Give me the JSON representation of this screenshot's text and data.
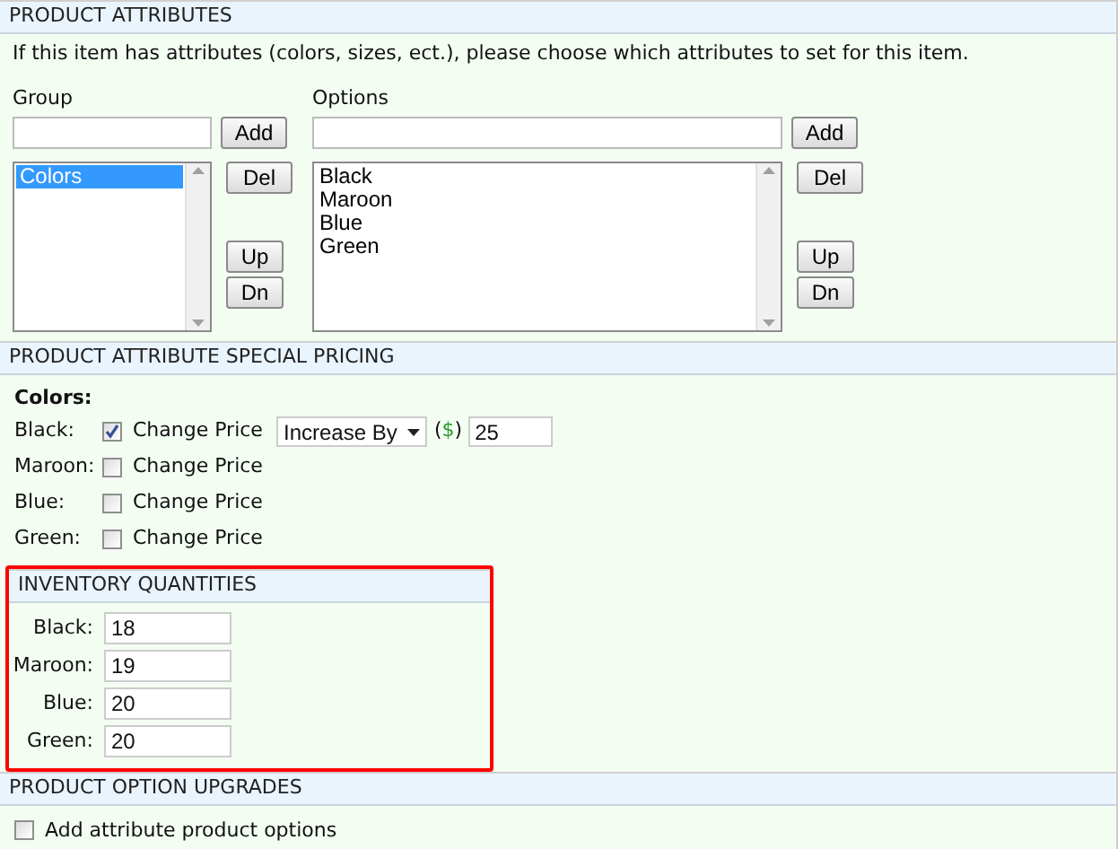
{
  "attributes": {
    "title": "PRODUCT ATTRIBUTES",
    "intro": "If this item has attributes (colors, sizes, ect.), please choose which attributes to set for this item.",
    "group": {
      "label": "Group",
      "add": "Add",
      "del": "Del",
      "up": "Up",
      "dn": "Dn",
      "items": [
        {
          "label": "Colors",
          "selected": true
        }
      ]
    },
    "options": {
      "label": "Options",
      "add": "Add",
      "del": "Del",
      "up": "Up",
      "dn": "Dn",
      "items": [
        {
          "label": "Black",
          "selected": false
        },
        {
          "label": "Maroon",
          "selected": false
        },
        {
          "label": "Blue",
          "selected": false
        },
        {
          "label": "Green",
          "selected": false
        }
      ]
    }
  },
  "pricing": {
    "title": "PRODUCT ATTRIBUTE SPECIAL PRICING",
    "group_label": "Colors:",
    "rows": [
      {
        "label": "Black:",
        "checked": true,
        "checkbox_label": "Change Price",
        "mode": "Increase By",
        "currency_open": "(",
        "currency": "$",
        "currency_close": ")",
        "amount": "25"
      },
      {
        "label": "Maroon:",
        "checked": false,
        "checkbox_label": "Change Price"
      },
      {
        "label": "Blue:",
        "checked": false,
        "checkbox_label": "Change Price"
      },
      {
        "label": "Green:",
        "checked": false,
        "checkbox_label": "Change Price"
      }
    ]
  },
  "inventory": {
    "title": "INVENTORY QUANTITIES",
    "highlighted": true,
    "rows": [
      {
        "label": "Black:",
        "value": "18"
      },
      {
        "label": "Maroon:",
        "value": "19"
      },
      {
        "label": "Blue:",
        "value": "20"
      },
      {
        "label": "Green:",
        "value": "20"
      }
    ]
  },
  "upgrades": {
    "title": "PRODUCT OPTION UPGRADES",
    "checked": false,
    "checkbox_label": "Add attribute product options"
  }
}
